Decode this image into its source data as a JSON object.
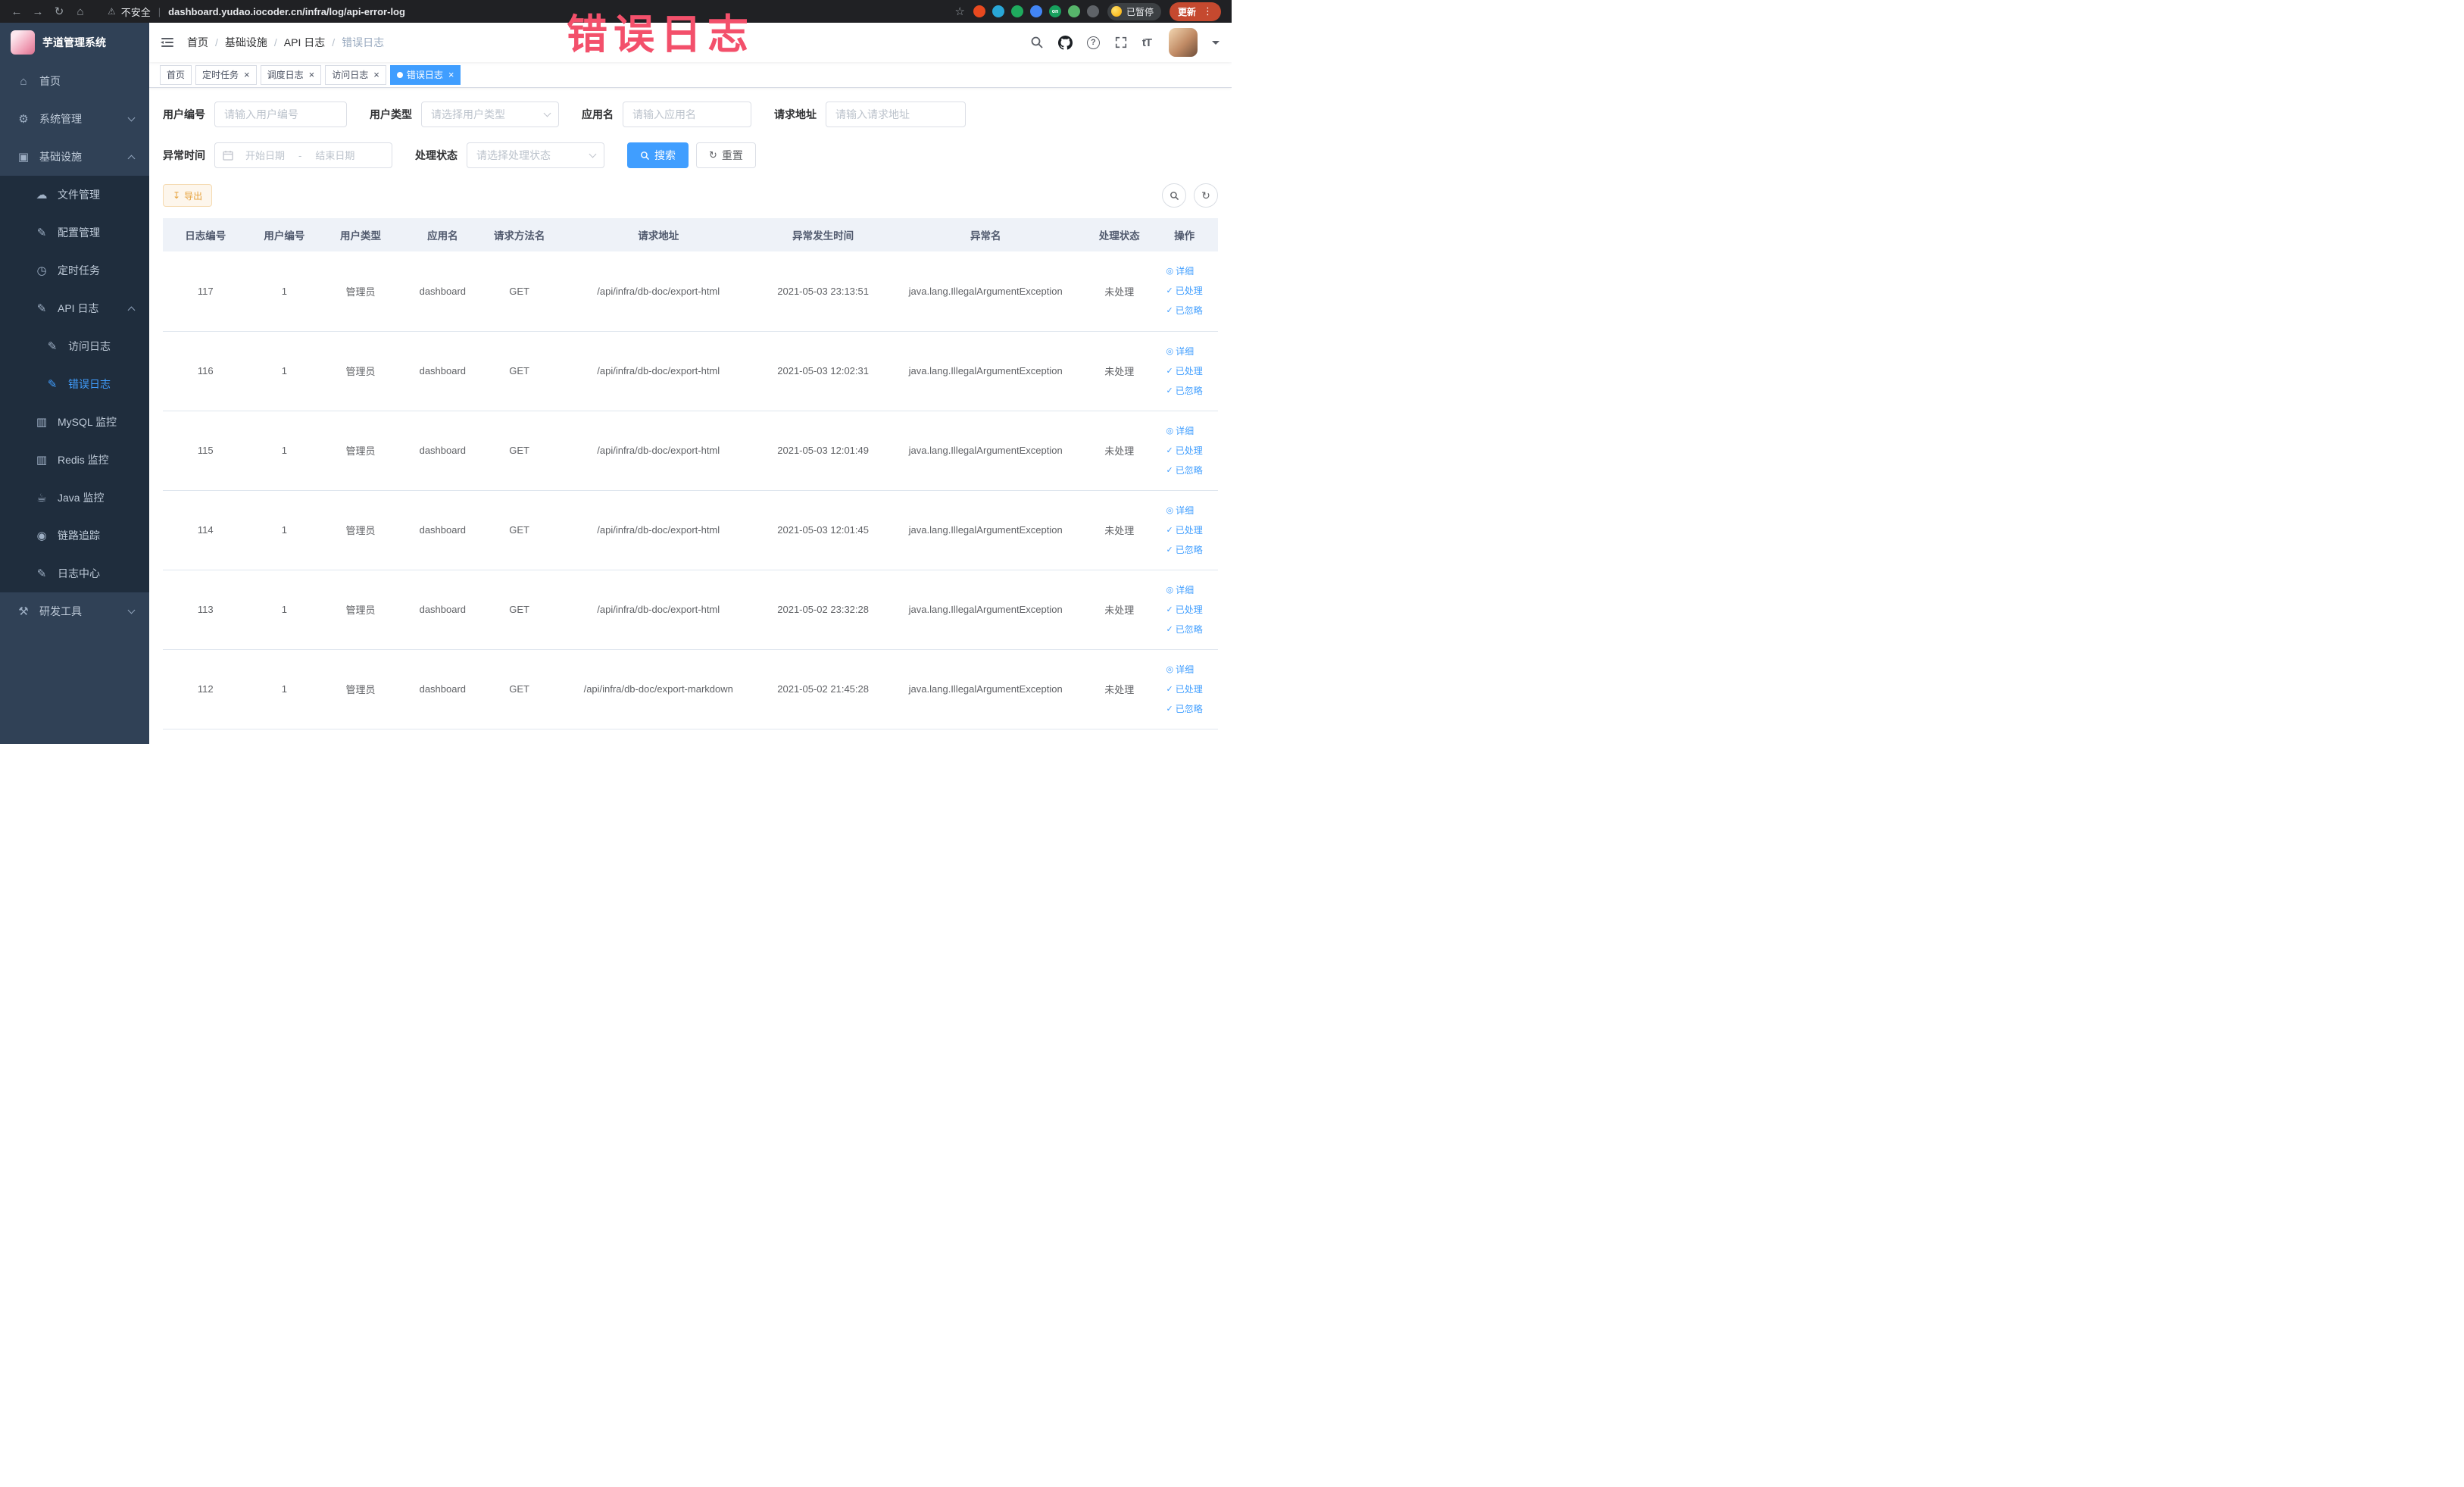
{
  "browser": {
    "security_label": "不安全",
    "url": "dashboard.yudao.iocoder.cn/infra/log/api-error-log",
    "paused_badge": "已暂停",
    "update_button": "更新",
    "extensions": [
      {
        "color": "#e8491f"
      },
      {
        "color": "#29a7d7"
      },
      {
        "color": "#1fab5e"
      },
      {
        "color": "#4285f4"
      },
      {
        "color": "#17a05d",
        "label": "on"
      },
      {
        "color": "#57b66b"
      },
      {
        "color": "#5f6368"
      }
    ]
  },
  "annotation": {
    "text": "错误日志",
    "color": "#f3506b"
  },
  "sidebar": {
    "logo_title": "芋道管理系统",
    "items": [
      {
        "key": "home",
        "label": "首页",
        "icon": "home",
        "level": 1
      },
      {
        "key": "system-management",
        "label": "系统管理",
        "icon": "gear",
        "level": 1,
        "chevron": "down"
      },
      {
        "key": "infrastructure",
        "label": "基础设施",
        "icon": "monitor",
        "level": 1,
        "chevron": "up"
      },
      {
        "key": "file-management",
        "label": "文件管理",
        "icon": "cloud",
        "level": 2
      },
      {
        "key": "config-management",
        "label": "配置管理",
        "icon": "edit",
        "level": 2
      },
      {
        "key": "scheduled-tasks",
        "label": "定时任务",
        "icon": "clock",
        "level": 2
      },
      {
        "key": "api-log",
        "label": "API 日志",
        "icon": "note",
        "level": 2,
        "chevron": "up"
      },
      {
        "key": "access-log",
        "label": "访问日志",
        "icon": "note",
        "level": 3
      },
      {
        "key": "error-log",
        "label": "错误日志",
        "icon": "note",
        "level": 3,
        "active": true
      },
      {
        "key": "mysql-monitor",
        "label": "MySQL 监控",
        "icon": "database",
        "level": 2
      },
      {
        "key": "redis-monitor",
        "label": "Redis 监控",
        "icon": "database",
        "level": 2
      },
      {
        "key": "java-monitor",
        "label": "Java 监控",
        "icon": "coffee",
        "level": 2
      },
      {
        "key": "trace",
        "label": "链路追踪",
        "icon": "eye",
        "level": 2
      },
      {
        "key": "log-center",
        "label": "日志中心",
        "icon": "note",
        "level": 2
      },
      {
        "key": "dev-tools",
        "label": "研发工具",
        "icon": "tool",
        "level": 1,
        "chevron": "down"
      }
    ]
  },
  "breadcrumb": {
    "items": [
      "首页",
      "基础设施",
      "API 日志",
      "错误日志"
    ]
  },
  "tabs": [
    {
      "key": "home",
      "label": "首页",
      "closable": false,
      "active": false
    },
    {
      "key": "scheduled-tasks",
      "label": "定时任务",
      "closable": true,
      "active": false
    },
    {
      "key": "schedule-log",
      "label": "调度日志",
      "closable": true,
      "active": false
    },
    {
      "key": "access-log",
      "label": "访问日志",
      "closable": true,
      "active": false
    },
    {
      "key": "error-log",
      "label": "错误日志",
      "closable": true,
      "active": true
    }
  ],
  "filters": {
    "user_id": {
      "label": "用户编号",
      "placeholder": "请输入用户编号"
    },
    "user_type": {
      "label": "用户类型",
      "placeholder": "请选择用户类型"
    },
    "app_name": {
      "label": "应用名",
      "placeholder": "请输入应用名"
    },
    "request_url": {
      "label": "请求地址",
      "placeholder": "请输入请求地址"
    },
    "exception_time": {
      "label": "异常时间",
      "start_placeholder": "开始日期",
      "end_placeholder": "结束日期",
      "separator": "-"
    },
    "process_status": {
      "label": "处理状态",
      "placeholder": "请选择处理状态"
    },
    "search_button": "搜索",
    "reset_button": "重置"
  },
  "toolbar": {
    "export_button": "导出"
  },
  "table": {
    "columns": [
      "日志编号",
      "用户编号",
      "用户类型",
      "应用名",
      "请求方法名",
      "请求地址",
      "异常发生时间",
      "异常名",
      "处理状态",
      "操作"
    ],
    "column_keys": [
      "id",
      "user_id",
      "user_type",
      "app",
      "method",
      "url",
      "time",
      "exception",
      "status"
    ],
    "actions": [
      {
        "key": "detail",
        "label": "详细",
        "icon": "view"
      },
      {
        "key": "processed",
        "label": "已处理",
        "icon": "check"
      },
      {
        "key": "ignored",
        "label": "已忽略",
        "icon": "check"
      }
    ],
    "rows": [
      {
        "id": "117",
        "user_id": "1",
        "user_type": "管理员",
        "app": "dashboard",
        "method": "GET",
        "url": "/api/infra/db-doc/export-html",
        "time": "2021-05-03 23:13:51",
        "exception": "java.lang.IllegalArgumentException",
        "status": "未处理"
      },
      {
        "id": "116",
        "user_id": "1",
        "user_type": "管理员",
        "app": "dashboard",
        "method": "GET",
        "url": "/api/infra/db-doc/export-html",
        "time": "2021-05-03 12:02:31",
        "exception": "java.lang.IllegalArgumentException",
        "status": "未处理"
      },
      {
        "id": "115",
        "user_id": "1",
        "user_type": "管理员",
        "app": "dashboard",
        "method": "GET",
        "url": "/api/infra/db-doc/export-html",
        "time": "2021-05-03 12:01:49",
        "exception": "java.lang.IllegalArgumentException",
        "status": "未处理"
      },
      {
        "id": "114",
        "user_id": "1",
        "user_type": "管理员",
        "app": "dashboard",
        "method": "GET",
        "url": "/api/infra/db-doc/export-html",
        "time": "2021-05-03 12:01:45",
        "exception": "java.lang.IllegalArgumentException",
        "status": "未处理"
      },
      {
        "id": "113",
        "user_id": "1",
        "user_type": "管理员",
        "app": "dashboard",
        "method": "GET",
        "url": "/api/infra/db-doc/export-html",
        "time": "2021-05-02 23:32:28",
        "exception": "java.lang.IllegalArgumentException",
        "status": "未处理"
      },
      {
        "id": "112",
        "user_id": "1",
        "user_type": "管理员",
        "app": "dashboard",
        "method": "GET",
        "url": "/api/infra/db-doc/export-markdown",
        "time": "2021-05-02 21:45:28",
        "exception": "java.lang.IllegalArgumentException",
        "status": "未处理"
      }
    ]
  },
  "icons": {
    "back": "←",
    "forward": "→",
    "reload": "↻",
    "chrome_home": "⌂",
    "warning": "⚠",
    "star": "☆",
    "kebab": "⋮",
    "home": "⌂",
    "gear": "⚙",
    "monitor": "▣",
    "cloud": "☁",
    "edit": "✎",
    "clock": "◷",
    "note": "✎",
    "database": "▥",
    "coffee": "☕",
    "eye": "◉",
    "tool": "⚒",
    "view": "◎",
    "check": "✓",
    "download": "↧",
    "refresh": "↻",
    "size": "tT",
    "help": "?"
  },
  "colors": {
    "accent": "#409eff",
    "annotation": "#f3506b",
    "sidebar_bg": "#304156",
    "submenu_bg": "#1f2d3d",
    "chrome_bg": "#202124",
    "warning_text": "#e6a23c",
    "table_header_bg": "#eef2f8"
  }
}
